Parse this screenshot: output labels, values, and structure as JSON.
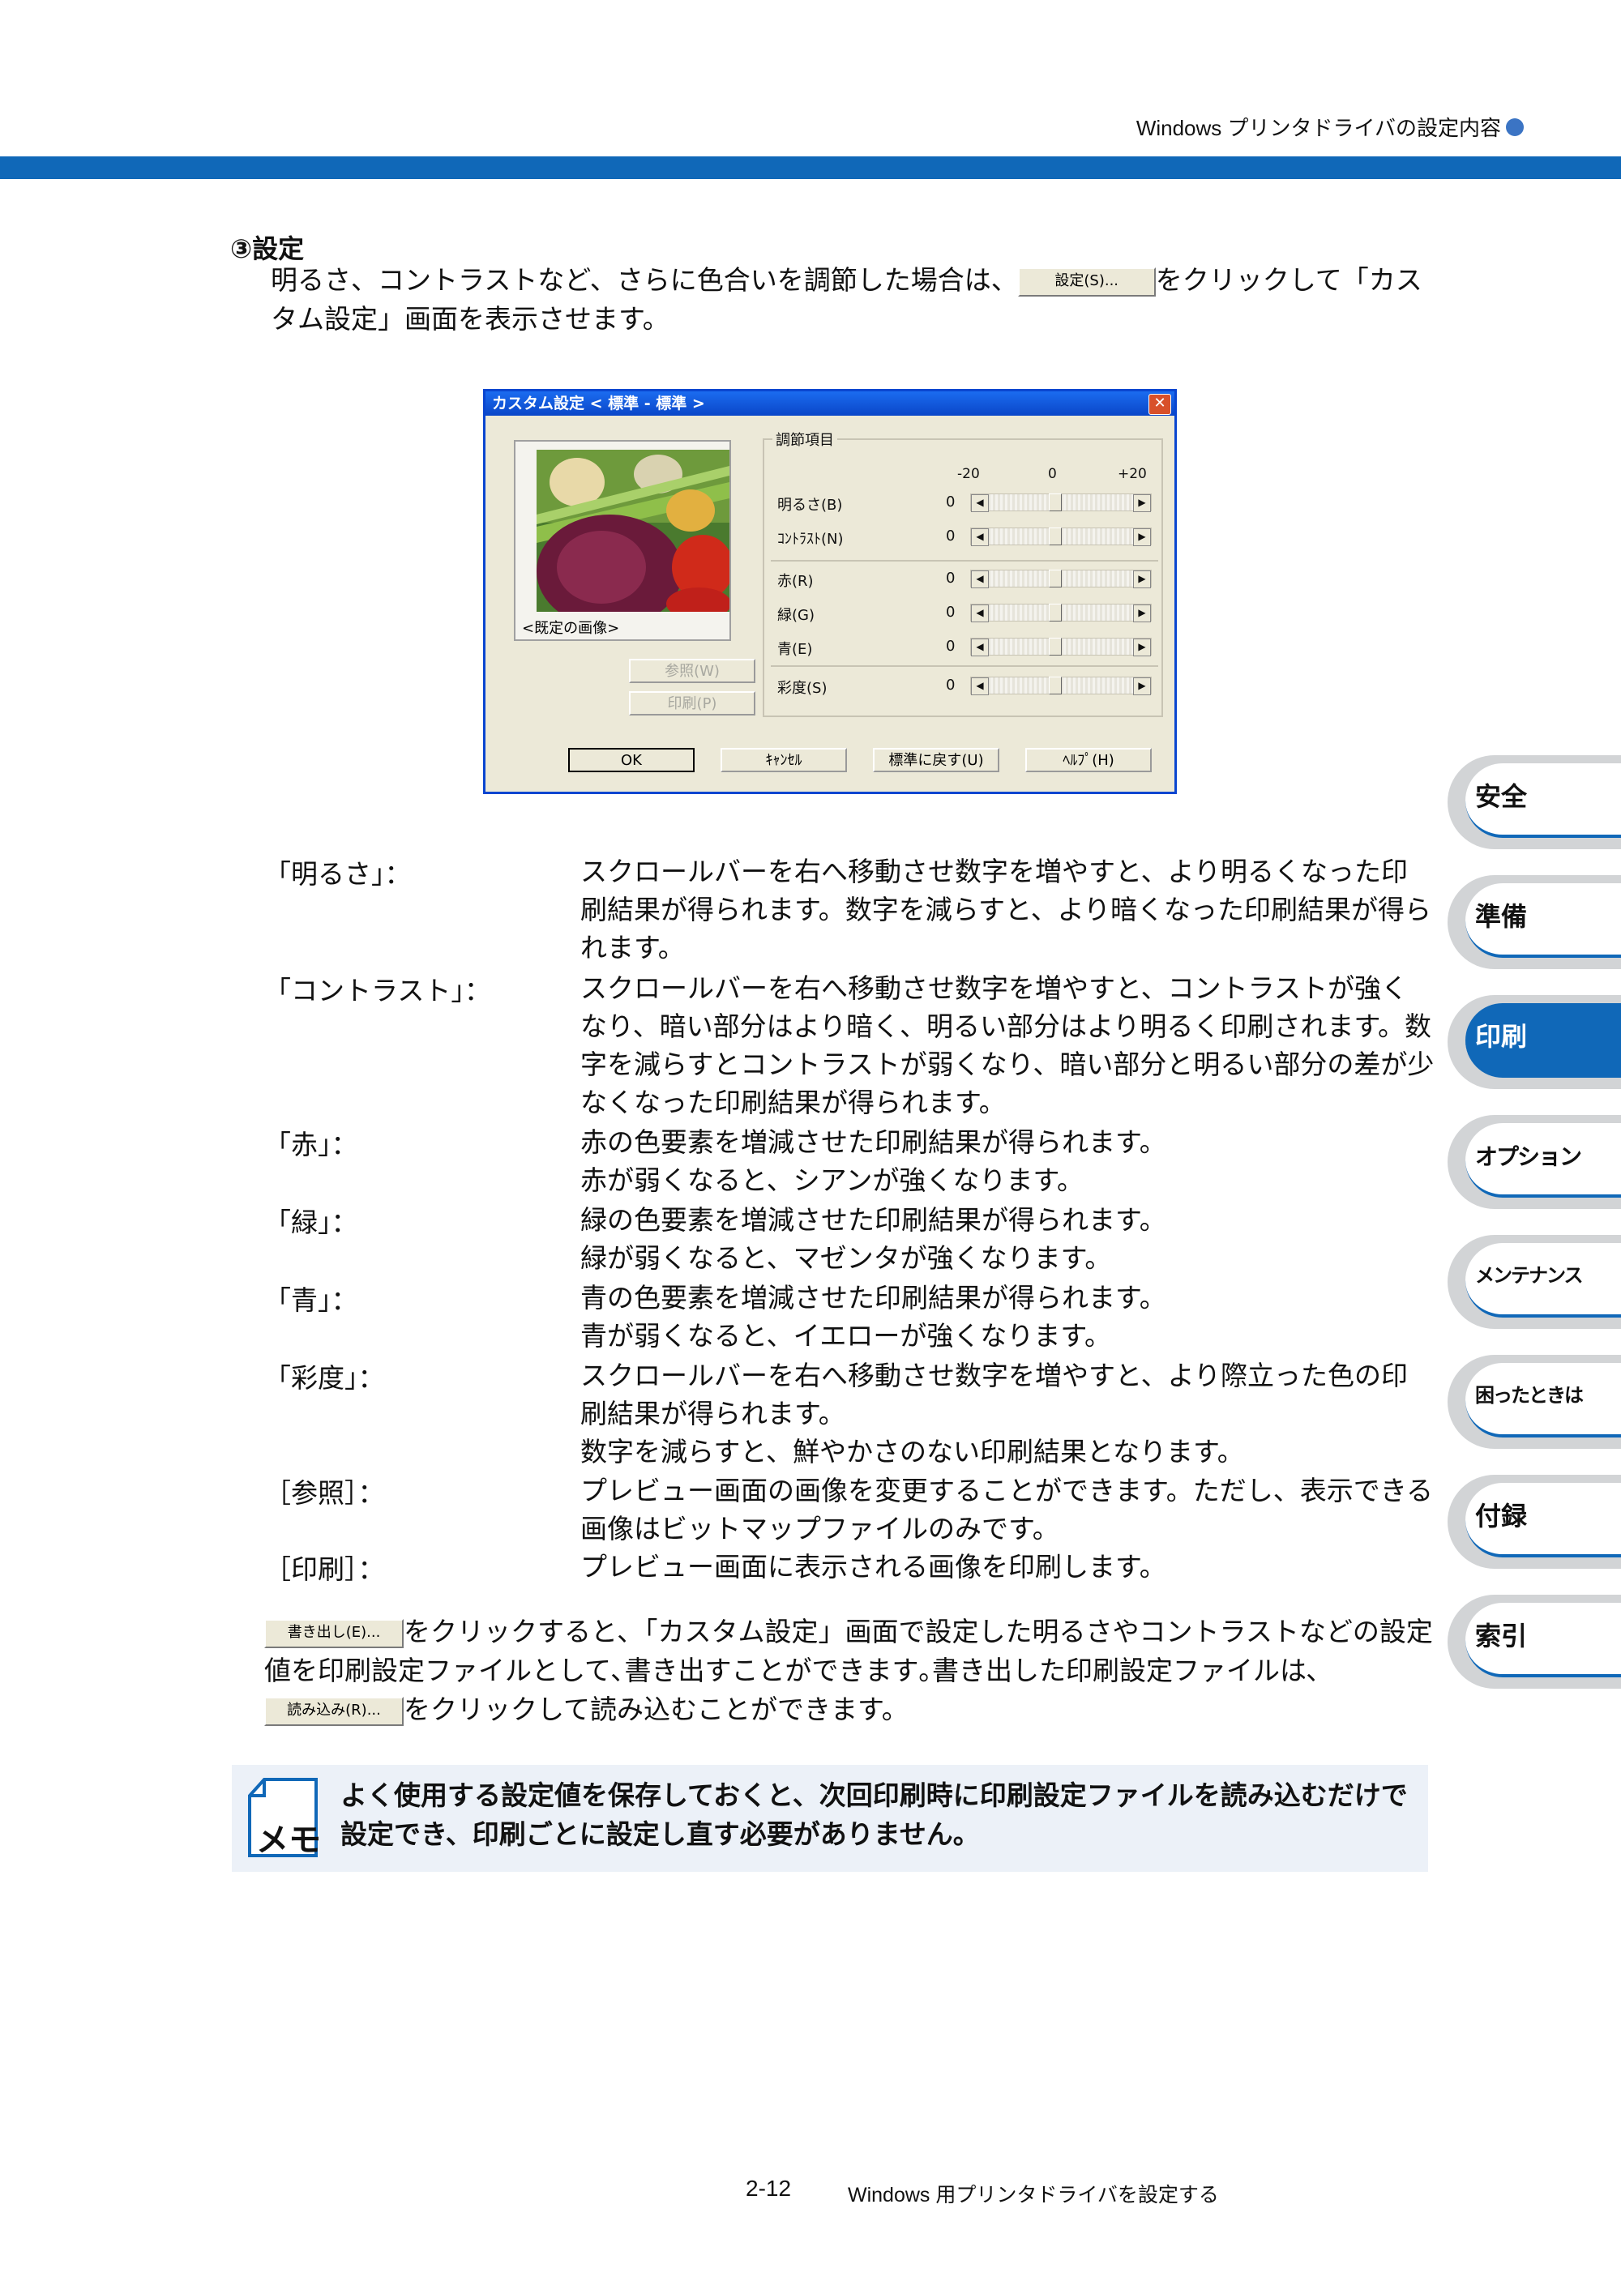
{
  "header": {
    "section_title": "Windows プリンタドライバの設定内容"
  },
  "section": {
    "title": "③設定",
    "intro_before": "明るさ、コントラストなど、さらに色合いを調節した場合は、",
    "intro_button": "設定(S)...",
    "intro_after": "をクリックして「カスタム設定」画面を表示させます。"
  },
  "dialog": {
    "title": "カスタム設定 < 標準 - 標準 >",
    "close": "✕",
    "preview_caption": "<既定の画像>",
    "browse_button": "参照(W)",
    "print_button": "印刷(P)",
    "group_label": "調節項目",
    "scale": {
      "min": "-20",
      "mid": "0",
      "max": "+20"
    },
    "sliders": [
      {
        "label": "明るさ(B)",
        "value": "0"
      },
      {
        "label": "ｺﾝﾄﾗｽﾄ(N)",
        "value": "0"
      },
      {
        "label": "赤(R)",
        "value": "0"
      },
      {
        "label": "緑(G)",
        "value": "0"
      },
      {
        "label": "青(E)",
        "value": "0"
      },
      {
        "label": "彩度(S)",
        "value": "0"
      }
    ],
    "buttons": {
      "ok": "OK",
      "cancel": "ｷｬﾝｾﾙ",
      "default": "標準に戻す(U)",
      "help": "ﾍﾙﾌﾟ(H)"
    }
  },
  "descriptions": [
    {
      "term": "「明るさ」：",
      "lines": [
        "スクロールバーを右へ移動させ数字を増やすと、より明るくなった印刷結果が得られます。数字を減らすと、より暗くなった印刷結果が得られます。"
      ]
    },
    {
      "term": "「コントラスト」：",
      "lines": [
        "スクロールバーを右へ移動させ数字を増やすと、コントラストが強くなり、暗い部分はより暗く、明るい部分はより明るく印刷されます。数字を減らすとコントラストが弱くなり、暗い部分と明るい部分の差が少なくなった印刷結果が得られます。"
      ]
    },
    {
      "term": "「赤」：",
      "lines": [
        "赤の色要素を増減させた印刷結果が得られます。",
        "赤が弱くなると、シアンが強くなります。"
      ]
    },
    {
      "term": "「緑」：",
      "lines": [
        "緑の色要素を増減させた印刷結果が得られます。",
        "緑が弱くなると、マゼンタが強くなります。"
      ]
    },
    {
      "term": "「青」：",
      "lines": [
        "青の色要素を増減させた印刷結果が得られます。",
        "青が弱くなると、イエローが強くなります。"
      ]
    },
    {
      "term": "「彩度」：",
      "lines": [
        "スクロールバーを右へ移動させ数字を増やすと、より際立った色の印刷結果が得られます。",
        "数字を減らすと、鮮やかさのない印刷結果となります。"
      ]
    },
    {
      "term": "［参照］：",
      "lines": [
        "プレビュー画面の画像を変更することができます。ただし、表示できる画像はビットマップファイルのみです。"
      ]
    },
    {
      "term": "［印刷］：",
      "lines": [
        "プレビュー画面に表示される画像を印刷します。"
      ]
    }
  ],
  "export_para": {
    "export_button": "書き出し(E)...",
    "text1": "をクリックすると､「カスタム設定」画面で設定した明るさやコントラストなどの設定値を印刷設定ファイルとして､書き出すことができます｡書き出した印刷設定ファイルは､",
    "import_button": "読み込み(R)...",
    "text2": "をクリックして読み込むことができます。"
  },
  "memo": {
    "icon_label": "メモ",
    "text": "よく使用する設定値を保存しておくと、次回印刷時に印刷設定ファイルを読み込むだけで設定でき、印刷ごとに設定し直す必要がありません。"
  },
  "tabs": [
    {
      "label": "安全",
      "active": false
    },
    {
      "label": "準備",
      "active": false
    },
    {
      "label": "印刷",
      "active": true
    },
    {
      "label": "オプション",
      "active": false
    },
    {
      "label": "メンテナンス",
      "active": false
    },
    {
      "label": "困ったときは",
      "active": false
    },
    {
      "label": "付録",
      "active": false
    },
    {
      "label": "索引",
      "active": false
    }
  ],
  "footer": {
    "page": "2-12",
    "title": "Windows 用プリンタドライバを設定する"
  },
  "colors": {
    "accent": "#1068b8",
    "tab_gray": "#d2d4d6",
    "memo_bg": "#ecf1f8"
  }
}
